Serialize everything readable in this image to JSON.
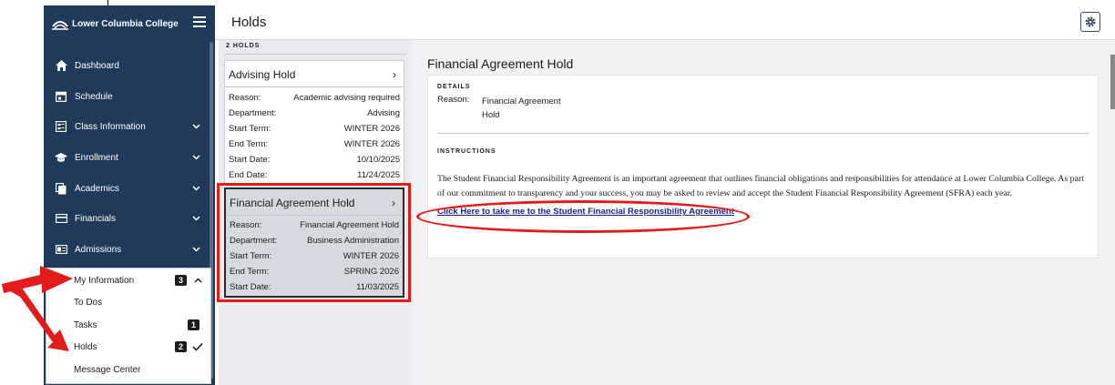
{
  "app": {
    "college_name": "Lower Columbia College"
  },
  "page": {
    "title": "Holds"
  },
  "sidebar": {
    "items": [
      {
        "label": "Dashboard",
        "icon": "home-icon"
      },
      {
        "label": "Schedule",
        "icon": "calendar-icon"
      },
      {
        "label": "Class Information",
        "icon": "class-info-icon"
      },
      {
        "label": "Enrollment",
        "icon": "graduation-cap-icon"
      },
      {
        "label": "Academics",
        "icon": "documents-icon"
      },
      {
        "label": "Financials",
        "icon": "credit-card-icon"
      },
      {
        "label": "Admissions",
        "icon": "id-card-icon"
      }
    ],
    "my_information": {
      "label": "My Information",
      "badge": "3",
      "children": [
        {
          "label": "To Dos",
          "badge": ""
        },
        {
          "label": "Tasks",
          "badge": "1"
        },
        {
          "label": "Holds",
          "badge": "2"
        },
        {
          "label": "Message Center",
          "badge": ""
        }
      ]
    }
  },
  "holds_list": {
    "header": "2 HOLDS",
    "holds": [
      {
        "title": "Advising Hold",
        "rows": [
          {
            "key": "Reason:",
            "value": "Academic advising required"
          },
          {
            "key": "Department:",
            "value": "Advising"
          },
          {
            "key": "Start Term:",
            "value": "WINTER 2026"
          },
          {
            "key": "End Term:",
            "value": "WINTER 2026"
          },
          {
            "key": "Start Date:",
            "value": "10/10/2025"
          },
          {
            "key": "End Date:",
            "value": "11/24/2025"
          }
        ]
      },
      {
        "title": "Financial Agreement Hold",
        "rows": [
          {
            "key": "Reason:",
            "value": "Financial Agreement Hold"
          },
          {
            "key": "Department:",
            "value": "Business Administration"
          },
          {
            "key": "Start Term:",
            "value": "WINTER 2026"
          },
          {
            "key": "End Term:",
            "value": "SPRING 2026"
          },
          {
            "key": "Start Date:",
            "value": "11/03/2025"
          }
        ]
      }
    ]
  },
  "detail": {
    "title": "Financial Agreement Hold",
    "details_label": "DETAILS",
    "reason_key": "Reason:",
    "reason_value": "Financial Agreement Hold",
    "instructions_label": "INSTRUCTIONS",
    "instructions_text": "The Student Financial Responsibility Agreement is an important agreement that outlines financial obligations and responsibilities for attendance at Lower Columbia College. As part of our commitment to transparency and your success, you may be asked to review and accept the Student Financial Responsibility Agreement (SFRA) each year.",
    "link_text": "Click Here to take me to the Student Financial Responsibility Agreement"
  },
  "colors": {
    "sidebar_bg": "#1f3a5a",
    "annotation_red": "#e41b1b",
    "link": "#1a237e"
  }
}
